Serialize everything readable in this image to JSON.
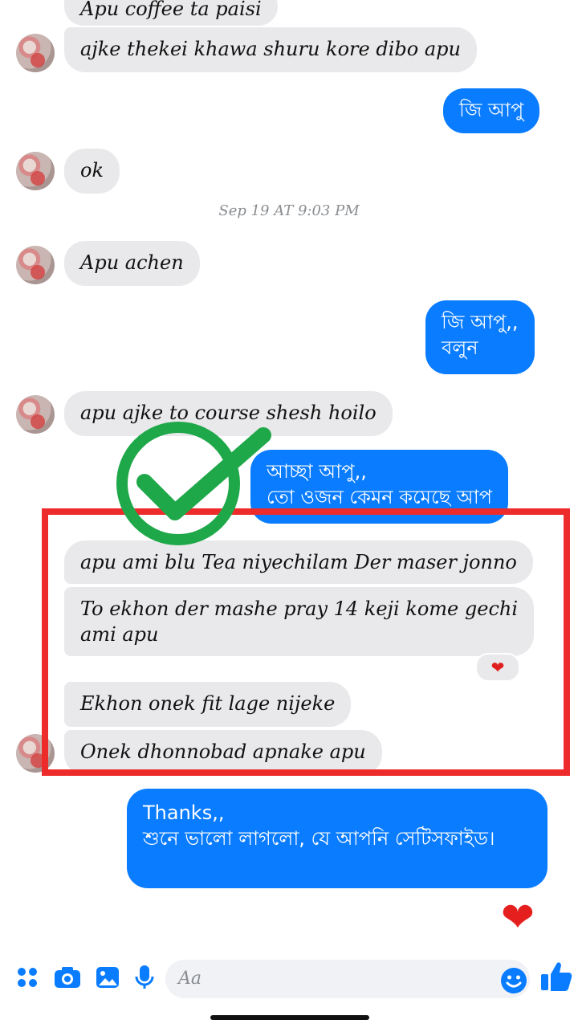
{
  "messages": {
    "m1": "Apu coffee ta paisi",
    "m2": "ajke thekei khawa shuru kore dibo apu",
    "m3": "জি আপু",
    "m4": "ok",
    "timestamp": "Sep 19 AT 9:03 PM",
    "m5": "Apu achen",
    "m6": "জি আপু,,\nবলুন",
    "m7": "apu ajke to course shesh hoilo",
    "m8": "আচ্ছা আপু,,\nতো ওজন কেমন কমেছে আপ",
    "m9": "apu ami blu Tea niyechilam Der maser jonno",
    "m10": "To ekhon der mashe pray 14 keji kome gechi\nami apu",
    "m11": "Ekhon onek fit lage nijeke",
    "m12": "Onek dhonnobad apnake apu",
    "m13": "Thanks,,\nশুনে ভালো লাগলো, যে আপনি সেটিসফাইড।"
  },
  "reactions": {
    "heart_reaction": "❤",
    "sent_heart": "❤"
  },
  "composer": {
    "placeholder": "Aa"
  },
  "icons": [
    "apps-icon",
    "camera-icon",
    "image-icon",
    "mic-icon",
    "emoji-icon",
    "like-icon"
  ],
  "colors": {
    "accent": "#0a7cff",
    "highlight": "#ee2b2b",
    "check": "#1fa84a"
  }
}
